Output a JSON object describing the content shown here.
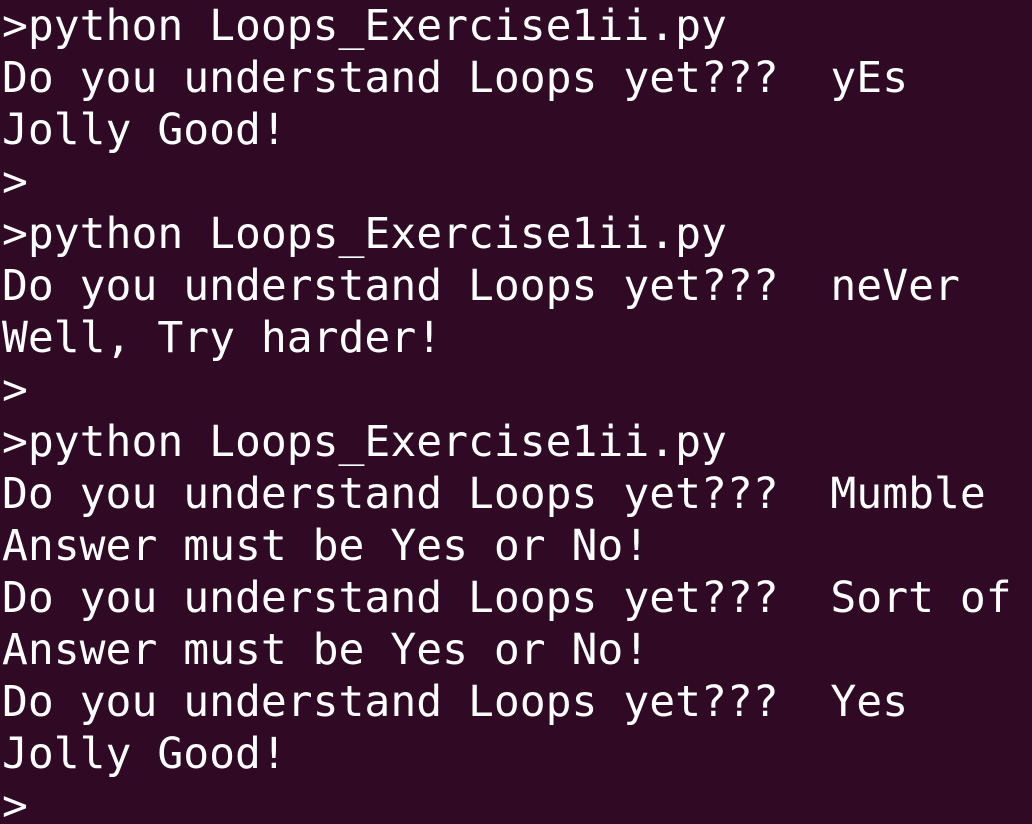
{
  "terminal": {
    "background": "#300a24",
    "foreground": "#ffffff",
    "lines": [
      ">python Loops_Exercise1ii.py",
      "Do you understand Loops yet???  yEs",
      "Jolly Good!",
      ">",
      ">python Loops_Exercise1ii.py",
      "Do you understand Loops yet???  neVer",
      "Well, Try harder!",
      ">",
      ">python Loops_Exercise1ii.py",
      "Do you understand Loops yet???  Mumble",
      "Answer must be Yes or No!",
      "Do you understand Loops yet???  Sort of",
      "Answer must be Yes or No!",
      "Do you understand Loops yet???  Yes",
      "Jolly Good!",
      ">"
    ]
  }
}
